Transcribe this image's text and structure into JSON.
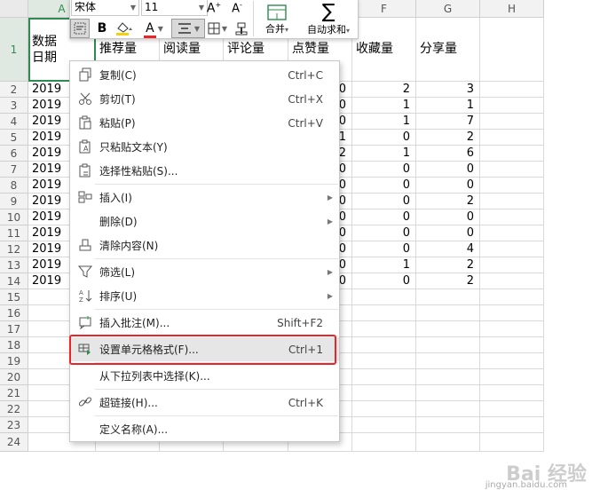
{
  "columns": [
    "A",
    "B",
    "C",
    "D",
    "E",
    "F",
    "G",
    "H"
  ],
  "rows": [
    "1",
    "2",
    "3",
    "4",
    "5",
    "6",
    "7",
    "8",
    "9",
    "10",
    "11",
    "12",
    "13",
    "14",
    "15",
    "16",
    "17",
    "18",
    "19",
    "20",
    "21",
    "22",
    "23",
    "24"
  ],
  "headers": {
    "a": "数据\n日期",
    "b": "推荐量",
    "c": "阅读量",
    "d": "评论量",
    "e": "点赞量",
    "f": "收藏量",
    "g": "分享量"
  },
  "col_a": [
    "2019",
    "2019",
    "2019",
    "2019",
    "2019",
    "2019",
    "2019",
    "2019",
    "2019",
    "2019",
    "2019",
    "2019",
    "2019"
  ],
  "col_e": [
    "0",
    "0",
    "0",
    "1",
    "2",
    "0",
    "0",
    "0",
    "0",
    "0",
    "0",
    "0",
    "0"
  ],
  "col_f": [
    "2",
    "1",
    "1",
    "0",
    "1",
    "0",
    "0",
    "0",
    "0",
    "0",
    "0",
    "1",
    "0"
  ],
  "col_g": [
    "3",
    "1",
    "7",
    "2",
    "6",
    "0",
    "0",
    "2",
    "0",
    "0",
    "4",
    "2",
    "2"
  ],
  "toolbar": {
    "font_name": "宋体",
    "font_size": "11",
    "merge_label": "合并",
    "autosum_label": "自动求和",
    "bold": "B",
    "font_color_letter": "A"
  },
  "menu": {
    "copy": {
      "label": "复制(C)",
      "shortcut": "Ctrl+C"
    },
    "cut": {
      "label": "剪切(T)",
      "shortcut": "Ctrl+X"
    },
    "paste": {
      "label": "粘贴(P)",
      "shortcut": "Ctrl+V"
    },
    "paste_text": {
      "label": "只粘贴文本(Y)"
    },
    "paste_special": {
      "label": "选择性粘贴(S)..."
    },
    "insert": {
      "label": "插入(I)"
    },
    "delete": {
      "label": "删除(D)"
    },
    "clear": {
      "label": "清除内容(N)"
    },
    "filter": {
      "label": "筛选(L)"
    },
    "sort": {
      "label": "排序(U)"
    },
    "comment": {
      "label": "插入批注(M)...",
      "shortcut": "Shift+F2"
    },
    "format_cells": {
      "label": "设置单元格格式(F)...",
      "shortcut": "Ctrl+1"
    },
    "pick_list": {
      "label": "从下拉列表中选择(K)..."
    },
    "hyperlink": {
      "label": "超链接(H)...",
      "shortcut": "Ctrl+K"
    },
    "define_name": {
      "label": "定义名称(A)..."
    }
  },
  "watermark": {
    "text": "Bai 经验",
    "sub": "jingyan.baidu.com"
  },
  "colors": {
    "selection": "#2e8b4f",
    "highlight_box": "#e8262a",
    "menu_hover": "#e6e6e6"
  }
}
